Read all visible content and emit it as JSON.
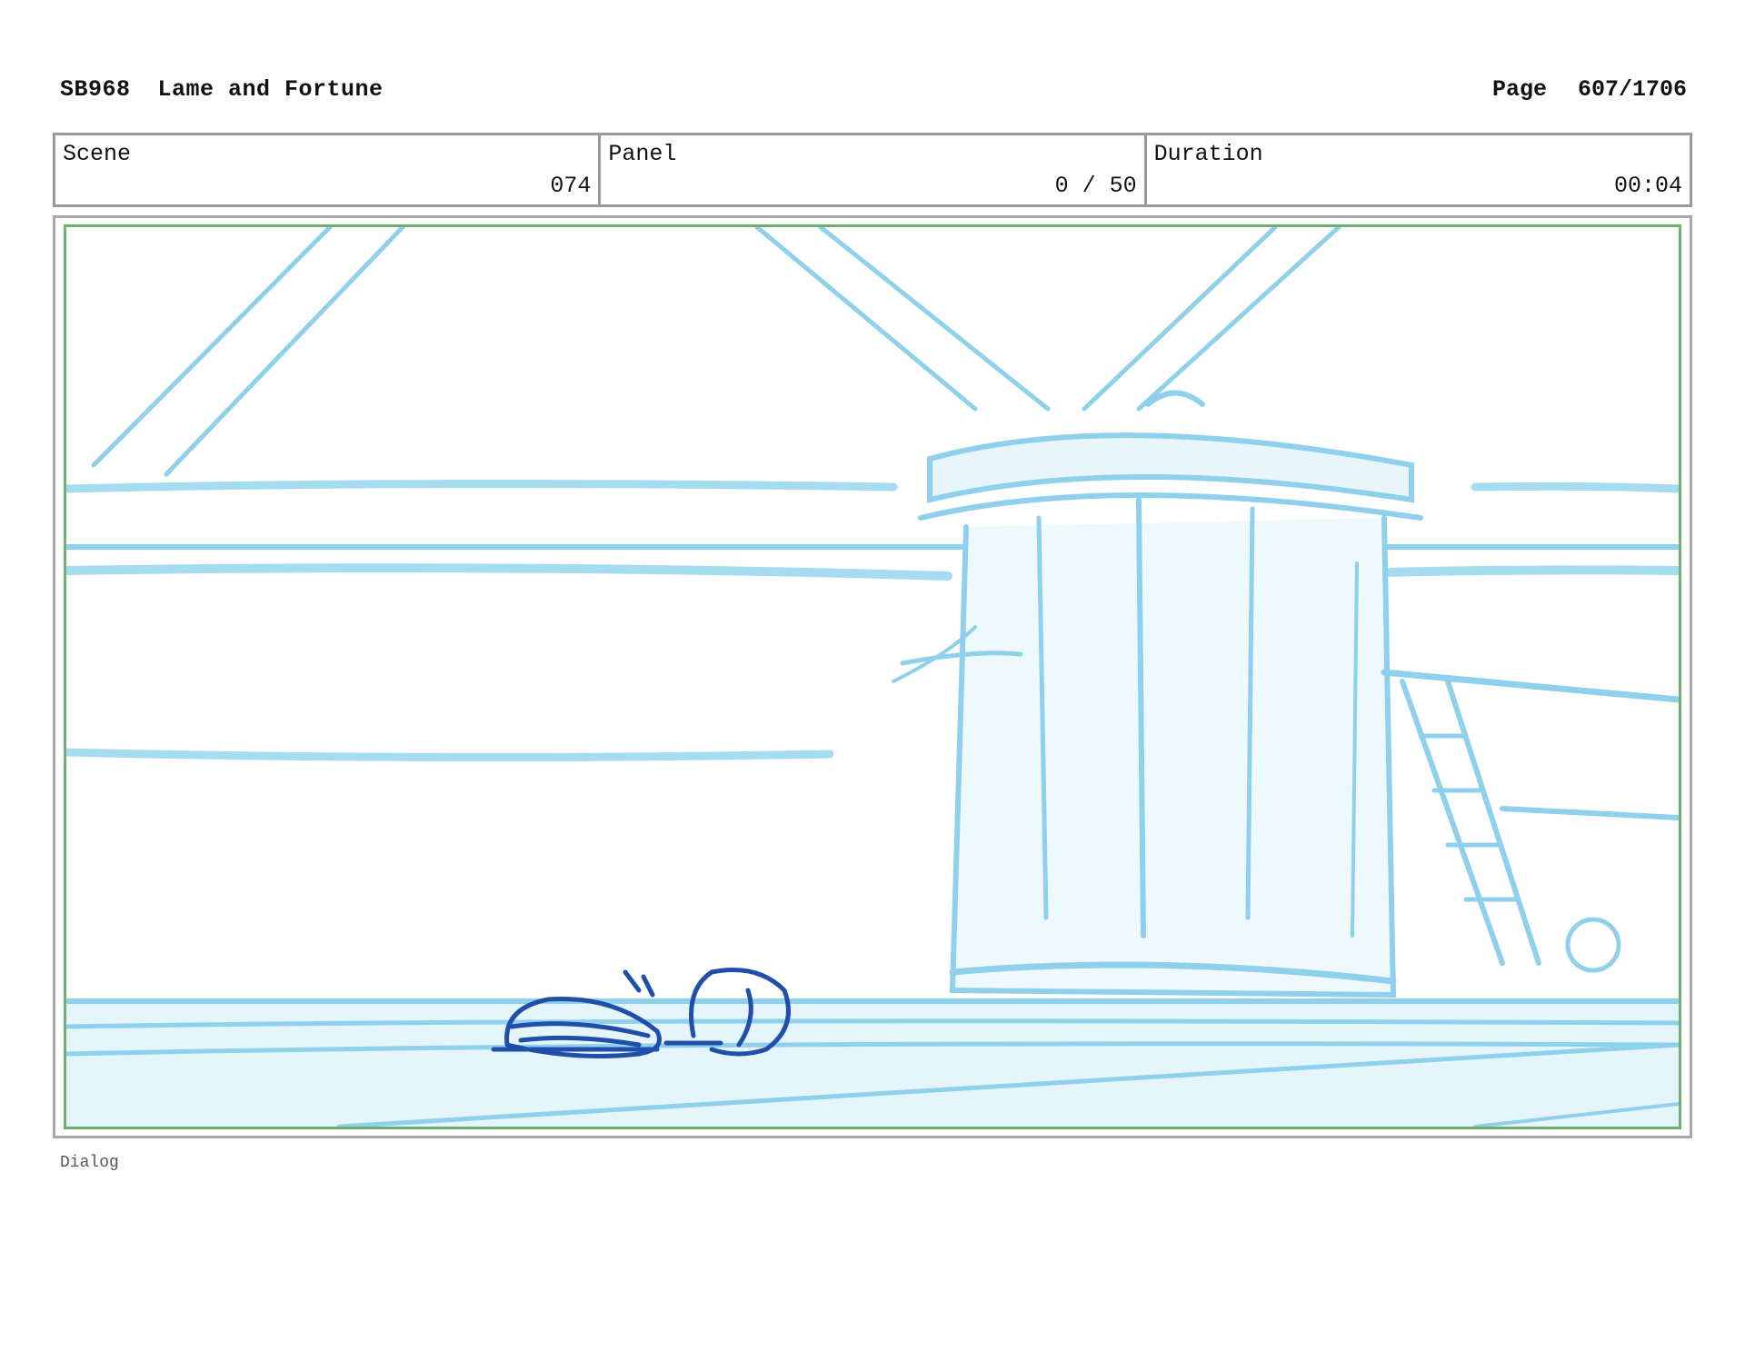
{
  "header": {
    "board_id": "SB968",
    "title": "Lame and Fortune",
    "page_label": "Page",
    "page_value": "607/1706"
  },
  "info": {
    "scene_label": "Scene",
    "scene_value": "074",
    "panel_label": "Panel",
    "panel_value": "0 / 50",
    "duration_label": "Duration",
    "duration_value": "00:04"
  },
  "footer": {
    "dialog_label": "Dialog"
  },
  "colors": {
    "layout_sketch": "#8fd0ec",
    "character_ink": "#1f4fa8",
    "panel_border": "#6fae6f"
  }
}
